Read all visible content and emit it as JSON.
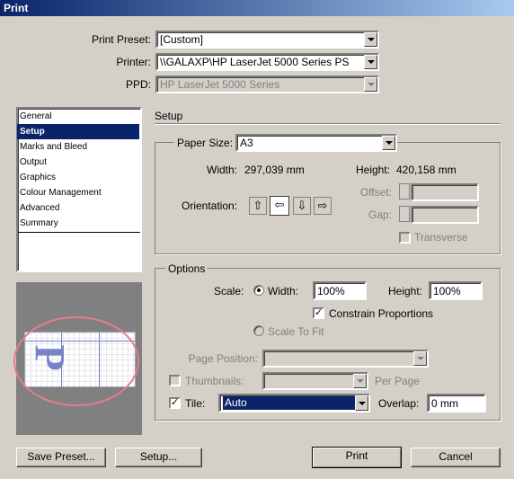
{
  "window": {
    "title": "Print"
  },
  "top": {
    "preset_label": "Print Preset:",
    "preset_value": "[Custom]",
    "printer_label": "Printer:",
    "printer_value": "\\\\GALAXP\\HP LaserJet 5000 Series PS",
    "ppd_label": "PPD:",
    "ppd_value": "HP LaserJet 5000 Series"
  },
  "categories": [
    "General",
    "Setup",
    "Marks and Bleed",
    "Output",
    "Graphics",
    "Colour Management",
    "Advanced",
    "Summary"
  ],
  "selected_category": "Setup",
  "setup": {
    "heading": "Setup",
    "paper_size_label": "Paper Size:",
    "paper_size_value": "A3",
    "width_label": "Width:",
    "width_value": "297,039 mm",
    "height_label": "Height:",
    "height_value": "420,158 mm",
    "orientation_label": "Orientation:",
    "offset_label": "Offset:",
    "gap_label": "Gap:",
    "transverse_label": "Transverse"
  },
  "options": {
    "legend": "Options",
    "scale_label": "Scale:",
    "width_radio_label": "Width:",
    "scale_width": "100%",
    "height_label": "Height:",
    "scale_height": "100%",
    "constrain_label": "Constrain Proportions",
    "constrain_checked": true,
    "scale_to_fit_label": "Scale To Fit",
    "page_position_label": "Page Position:",
    "thumbnails_label": "Thumbnails:",
    "per_page_label": "Per Page",
    "tile_label": "Tile:",
    "tile_checked": true,
    "tile_value": "Auto",
    "overlap_label": "Overlap:",
    "overlap_value": "0 mm"
  },
  "preview": {
    "letter": "P"
  },
  "buttons": {
    "save_preset": "Save Preset...",
    "setup": "Setup...",
    "print": "Print",
    "cancel": "Cancel"
  },
  "colors": {
    "selection": "#0a246a",
    "dialog": "#d4d0c8",
    "annotation": "#e87a8a"
  },
  "icons": [
    "portrait-icon",
    "landscape-icon",
    "reverse-portrait-icon",
    "reverse-landscape-icon",
    "dropdown-arrow-icon",
    "spinner-icon"
  ]
}
